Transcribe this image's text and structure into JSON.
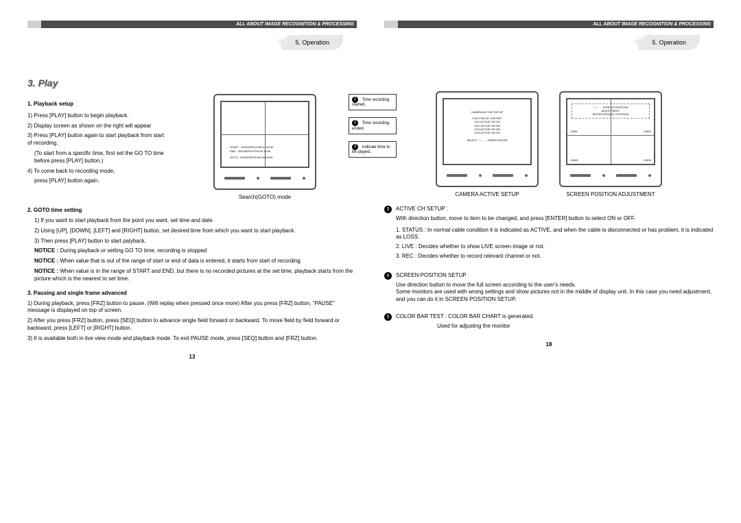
{
  "header_bar": "ALL ABOUT IMAGE RECOGNITION & PROCESSING",
  "op_label": "5. Operation",
  "left": {
    "title": "3.  Play",
    "sec1_head": "1. Playback setup",
    "s1_1": "1) Press [PLAY] button to begin playback.",
    "s1_2": "2) Display screen as shown on the right will appear",
    "s1_3": "3) Press [PLAY] button again to start playback from start of recording.",
    "s1_3_note": "(To start from a specific time, first set the GO TO time before press [PLAY] button.)",
    "s1_4": "4) To come back to recording mode,",
    "s1_4b": "press [PLAY] button again.",
    "goto_label": "Search(GOTO) mode",
    "goto_lines": {
      "a": "START        :    2002/APR/12    AM 07:40:36",
      "b": "END            :    2002/APR/29    PM 02:11:56",
      "c": "GOTO         :    2002/APR/15    AM 00:00:06"
    },
    "callout1": "Time recording started.",
    "callout2": "Time recording ended.",
    "callout3": "Indicate time to be played.",
    "sec2_head": "2. GOTO time setting",
    "s2_1": "1) If you want to start playback from the point you want, set time and date.",
    "s2_2": "2)  Using [UP], [DOWN], [LEFT] and [RIGHT] button, set desired time from which you want to start playback.",
    "s2_3": "3) Then press [PLAY] button to start palyback.",
    "s2_n1": "During playback or setting GO TO time, recording is stopped",
    "s2_n2": "When value that is out of the range of start or end of data is entered, it starts from start of recording.",
    "s2_n3": "When value is in the range of START and END, but there is no recorded pictures at the set time, playback starts from the picture which is the nearest to set time.",
    "sec3_head": "3. Pausing and single frame advanced",
    "s3_1": "1) During playback, press [FRZ] button to pause. (Will replay when pressed once more) After you press [FRZ] button, \"PAUSE\" message is displayed on top of screen.",
    "s3_2": "2) After you press [FRZ] button, press [SEQ] button to advance single field forward or backward. To move field by field forward or backward, press [LEFT] or [RIGHT] button.",
    "s3_3": "3) It is available both in live view mode and playback mode. To exit PAUSE mode, press [SEQ] button and [FRZ] button.",
    "page_num": "13"
  },
  "right": {
    "cam_active_title": "CAMERA ACTIVE SETUP",
    "screen_pos_title": "SCREEN POSITION ADJUSTMENT",
    "cam_screen": {
      "header": "CAMERA ACTIVE SETUP",
      "cols": "CH#     STATUS     LIVE     REC",
      "rows": [
        "CH1     ACTIVE       ON       ON",
        "CH2     ACTIVE       ON       ON",
        "CH3     ACTIVE       ON       ON",
        "CH4     ACTIVE       ON       ON"
      ],
      "footer": "SELECT  ↑↓←→, PRESS ENTER"
    },
    "pos_screen": {
      "arrows": "↑↓←→",
      "l1": "SCREEN POSITION",
      "l2": "ADJUSTMENT",
      "enter": "ENTER        DEFAULT POSITION",
      "c1": "CAM1",
      "c2": "CAM2",
      "c3": "CAM3",
      "c4": "CAM4"
    },
    "item3_head": "ACTIVE CH SETUP :",
    "item3_body": "With direction button, move to item to be changed, and press [ENTER] button to select ON or OFF.",
    "item3_1": "1. STATUS : In normal cable condition it is indicated as ACTIVE, and when the cable is disconnected or has problem, it is indicated as LOSS.",
    "item3_2": "2. LIVE :  Decides whether to show LIVE screen image or not.",
    "item3_3": "3. REC : Decides whether to record relevant channel or not.",
    "item4_head": "SCREEN POSITION SETUP",
    "item4_body": "Use direction button to move the full screen according to the user's needs.\nSome monitors are used with wrong settings and show pictures not in the middle of display unit. In this case you need adjustment, and you can do it in SCREEN POSITION SETUP.",
    "item5_head": "COLOR BAR TEST : COLOR BAR CHART is generated.",
    "item5_body": "Used for adjusting the monitor",
    "page_num": "18"
  },
  "notice_label": "NOTICE :"
}
